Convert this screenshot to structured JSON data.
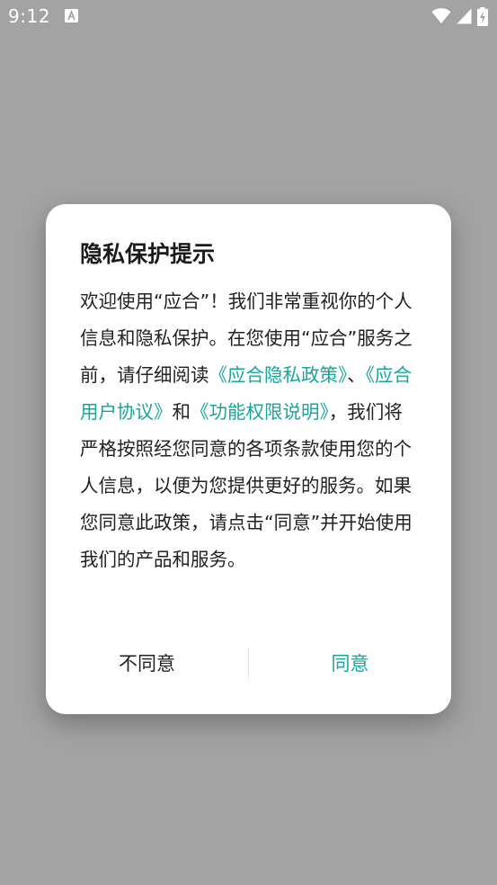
{
  "status_bar": {
    "time": "9:12",
    "notification_icon": "font-a-icon",
    "icons": [
      "wifi-icon",
      "signal-icon",
      "battery-charging-icon"
    ]
  },
  "dialog": {
    "title": "隐私保护提示",
    "body": {
      "text1": "欢迎使用“应合”！我们非常重视你的个人信息和隐私保护。在您使用“应合”服务之前，请仔细阅读",
      "link_privacy": "《应合隐私政策》",
      "sep1": "、",
      "link_user_agreement": "《应合用户协议》",
      "sep2": "和",
      "link_permissions": "《功能权限说明》",
      "text2": "，我们将严格按照经您同意的各项条款使用您的个人信息，以便为您提供更好的服务。如果您同意此政策，请点击“同意”并开始使用我们的产品和服务。"
    },
    "buttons": {
      "disagree": "不同意",
      "agree": "同意"
    }
  },
  "colors": {
    "accent": "#1aa59b",
    "scrim": "#a3a3a3",
    "text": "#222222"
  }
}
